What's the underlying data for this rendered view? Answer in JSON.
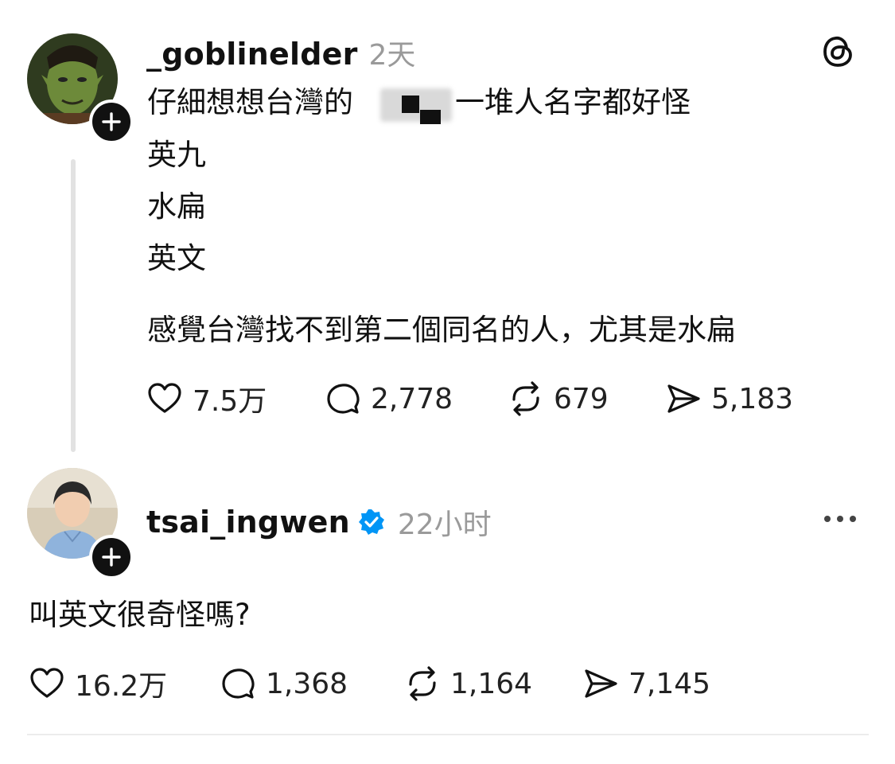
{
  "post1": {
    "username": "_goblinelder",
    "time": "2天",
    "lines": [
      "仔細想想台灣的",
      "一堆人名字都好怪",
      "英九",
      "水扁",
      "英文",
      "感覺台灣找不到第二個同名的人，尤其是水扁"
    ],
    "likes": "7.5万",
    "comments": "2,778",
    "reposts": "679",
    "shares": "5,183"
  },
  "post2": {
    "username": "tsai_ingwen",
    "time": "22小时",
    "text": "叫英文很奇怪嗎?",
    "likes": "16.2万",
    "comments": "1,368",
    "reposts": "1,164",
    "shares": "7,145"
  },
  "icons": {
    "app_logo": "threads-logo-icon",
    "more": "more-dots-icon",
    "like": "heart-icon",
    "comment": "comment-bubble-icon",
    "repost": "repost-icon",
    "share": "send-icon",
    "verified": "verified-badge-icon",
    "follow": "plus-icon"
  },
  "colors": {
    "verified_blue": "#0095f6",
    "muted_text": "#9a9a9a",
    "text": "#111111"
  }
}
